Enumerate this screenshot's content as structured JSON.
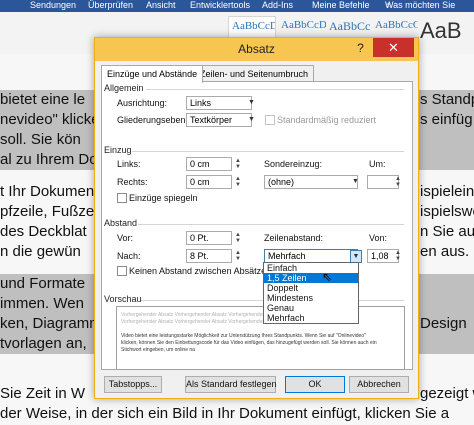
{
  "ribbon": {
    "tabs": [
      "Sendungen",
      "Überprüfen",
      "Ansicht",
      "Entwicklertools",
      "Add-Ins",
      "Meine Befehle",
      "Was möchten Sie"
    ],
    "styles": [
      "AaBbCcDc",
      "AaBbCcDc",
      "AaBbCc",
      "AaBbCcC"
    ],
    "big_style": "AaB"
  },
  "document": {
    "lines": [
      "bietet eine le",
      "nevideo\" klicker",
      "soll. Sie kön",
      "al zu Ihrem Do",
      "t Ihr Dokumen",
      "pfzeile, Fußze",
      "des Deckblat",
      "n die gewün",
      "und Formate",
      "immen. Wen",
      "ken, Diagramm",
      "tvorlagen an,",
      "Sie Zeit in W",
      "der Weise, in der sich ein Bild in Ihr Dokument einfügt, klicken Sie a"
    ],
    "right_lines": [
      "s Standp",
      "s einfüg",
      "",
      "",
      "ispieleinand",
      "ispielsweis",
      "n Sie auf",
      "en aus. ¶",
      "",
      "",
      "Design",
      "",
      "gezeigt we",
      ""
    ]
  },
  "dialog": {
    "title": "Absatz",
    "help": "?",
    "close": "✕",
    "tabs": [
      "Einzüge und Abstände",
      "Zeilen- und Seitenumbruch"
    ],
    "allgemein": {
      "title": "Allgemein",
      "ausrichtung_label": "Ausrichtung:",
      "ausrichtung_value": "Links",
      "gliederung_label": "Gliederungsebene:",
      "gliederung_value": "Textkörper",
      "standard_label": "Standardmäßig reduziert"
    },
    "einzug": {
      "title": "Einzug",
      "links_label": "Links:",
      "links_value": "0 cm",
      "rechts_label": "Rechts:",
      "rechts_value": "0 cm",
      "sonder_label": "Sondereinzug:",
      "sonder_value": "(ohne)",
      "um_label": "Um:",
      "spiegeln_label": "Einzüge spiegeln"
    },
    "abstand": {
      "title": "Abstand",
      "vor_label": "Vor:",
      "vor_value": "0 Pt.",
      "nach_label": "Nach:",
      "nach_value": "8 Pt.",
      "zeilen_label": "Zeilenabstand:",
      "zeilen_value": "Mehrfach",
      "von_label": "Von:",
      "von_value": "1,08",
      "keinen_label": "Keinen Abstand zwischen Absätzen gleich"
    },
    "dropdown_options": [
      "Einfach",
      "1,5 Zeilen",
      "Doppelt",
      "Mindestens",
      "Genau",
      "Mehrfach"
    ],
    "dropdown_selected": "1,5 Zeilen",
    "vorschau": {
      "title": "Vorschau",
      "gray_line_1": "Vorhergehender Absatz Vorhergehender Absatz Vorhergehender Absatz Vorhergehender Absatz",
      "gray_line_2": "Vorhergehender Absatz Vorhergehender Absatz Vorhergehender Absatz",
      "dark_line_1": "Video bietet eine leistungsstarke Möglichkeit zur Unterstützung Ihres Standpunkts. Wenn Sie auf \"Onlinevideo\"",
      "dark_line_2": "klicken, können Sie den Einbettungscode für das Video einfügen, das hinzugefügt werden soll. Sie können auch ein",
      "dark_line_3": "Stichwort eingeben, um online na"
    },
    "buttons": {
      "tabstopps": "Tabstopps...",
      "standard": "Als Standard festlegen",
      "ok": "OK",
      "abbrechen": "Abbrechen"
    }
  }
}
